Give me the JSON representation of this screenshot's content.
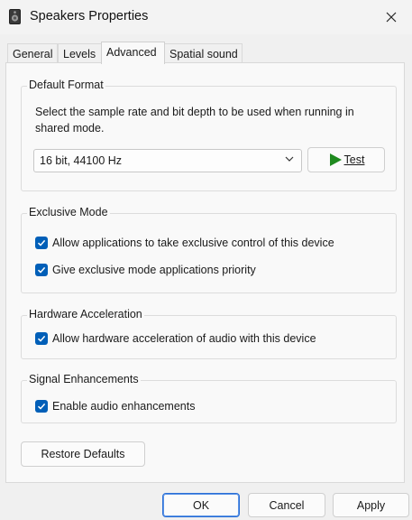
{
  "window": {
    "title": "Speakers Properties"
  },
  "tabs": [
    {
      "label": "General",
      "active": false
    },
    {
      "label": "Levels",
      "active": false
    },
    {
      "label": "Advanced",
      "active": true
    },
    {
      "label": "Spatial sound",
      "active": false
    }
  ],
  "default_format": {
    "title": "Default Format",
    "description": "Select the sample rate and bit depth to be used when running in shared mode.",
    "selected": "16 bit, 44100 Hz",
    "test_label": "Test"
  },
  "exclusive_mode": {
    "title": "Exclusive Mode",
    "allow_exclusive": {
      "label": "Allow applications to take exclusive control of this device",
      "checked": true
    },
    "priority": {
      "label": "Give exclusive mode applications priority",
      "checked": true
    }
  },
  "hardware_acceleration": {
    "title": "Hardware Acceleration",
    "allow_hw": {
      "label": "Allow hardware acceleration of audio with this device",
      "checked": true
    }
  },
  "signal_enhancements": {
    "title": "Signal Enhancements",
    "enable": {
      "label": "Enable audio enhancements",
      "checked": true
    }
  },
  "restore_defaults_label": "Restore Defaults",
  "footer": {
    "ok": "OK",
    "cancel": "Cancel",
    "apply": "Apply"
  },
  "colors": {
    "accent": "#005fb8",
    "play_green": "#1f8a1f"
  },
  "icons": {
    "app": "speaker-icon",
    "close": "close-icon",
    "play": "play-icon",
    "check": "checkmark-icon",
    "chevron": "chevron-down-icon"
  }
}
